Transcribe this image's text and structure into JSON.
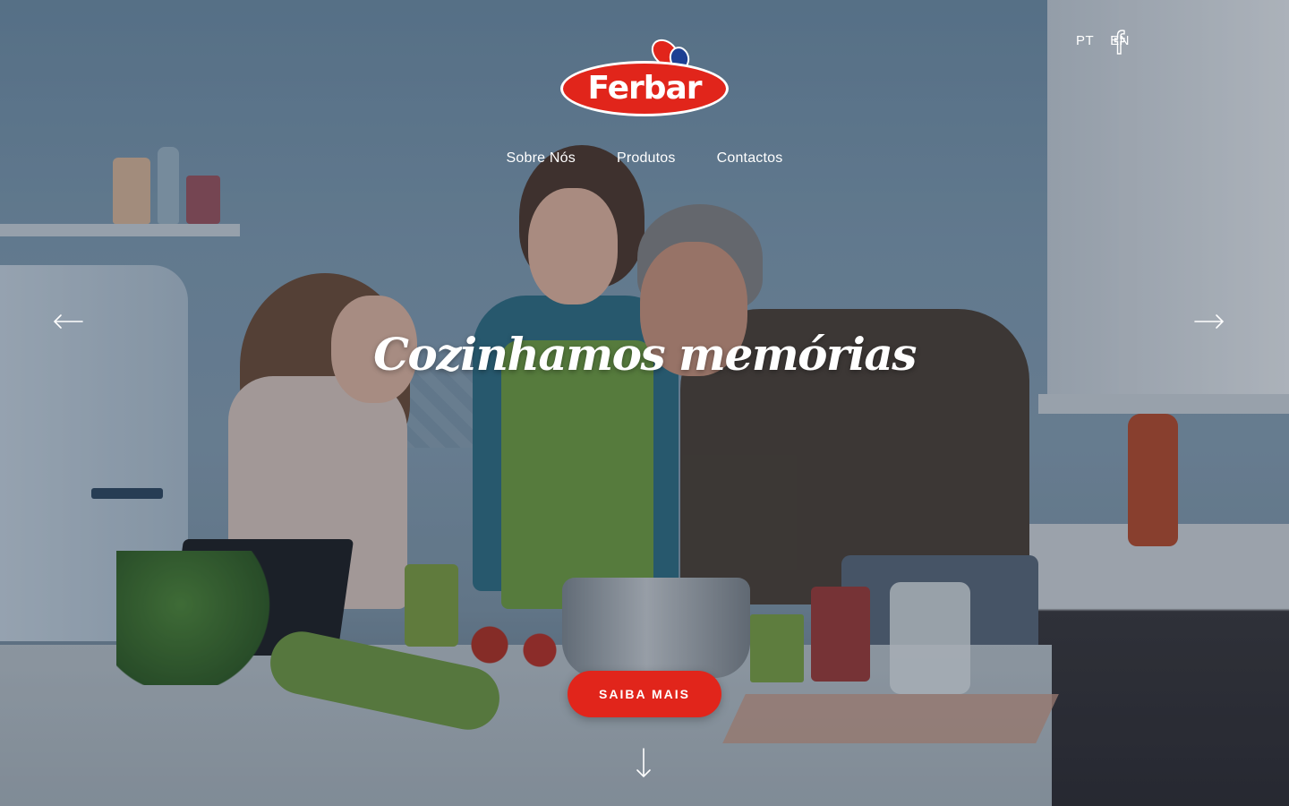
{
  "brand": {
    "logo_text": "Ferbar",
    "primary_color": "#e1251b",
    "accent_color": "#1d3f93"
  },
  "header": {
    "languages": [
      "PT",
      "EN"
    ],
    "social_icon": "facebook-icon"
  },
  "nav": {
    "items": [
      "Sobre Nós",
      "Produtos",
      "Contactos"
    ]
  },
  "hero": {
    "tagline": "Cozinhamos memórias",
    "cta_label": "SAIBA MAIS",
    "prev_icon": "arrow-left-icon",
    "next_icon": "arrow-right-icon",
    "scroll_icon": "arrow-down-icon"
  }
}
